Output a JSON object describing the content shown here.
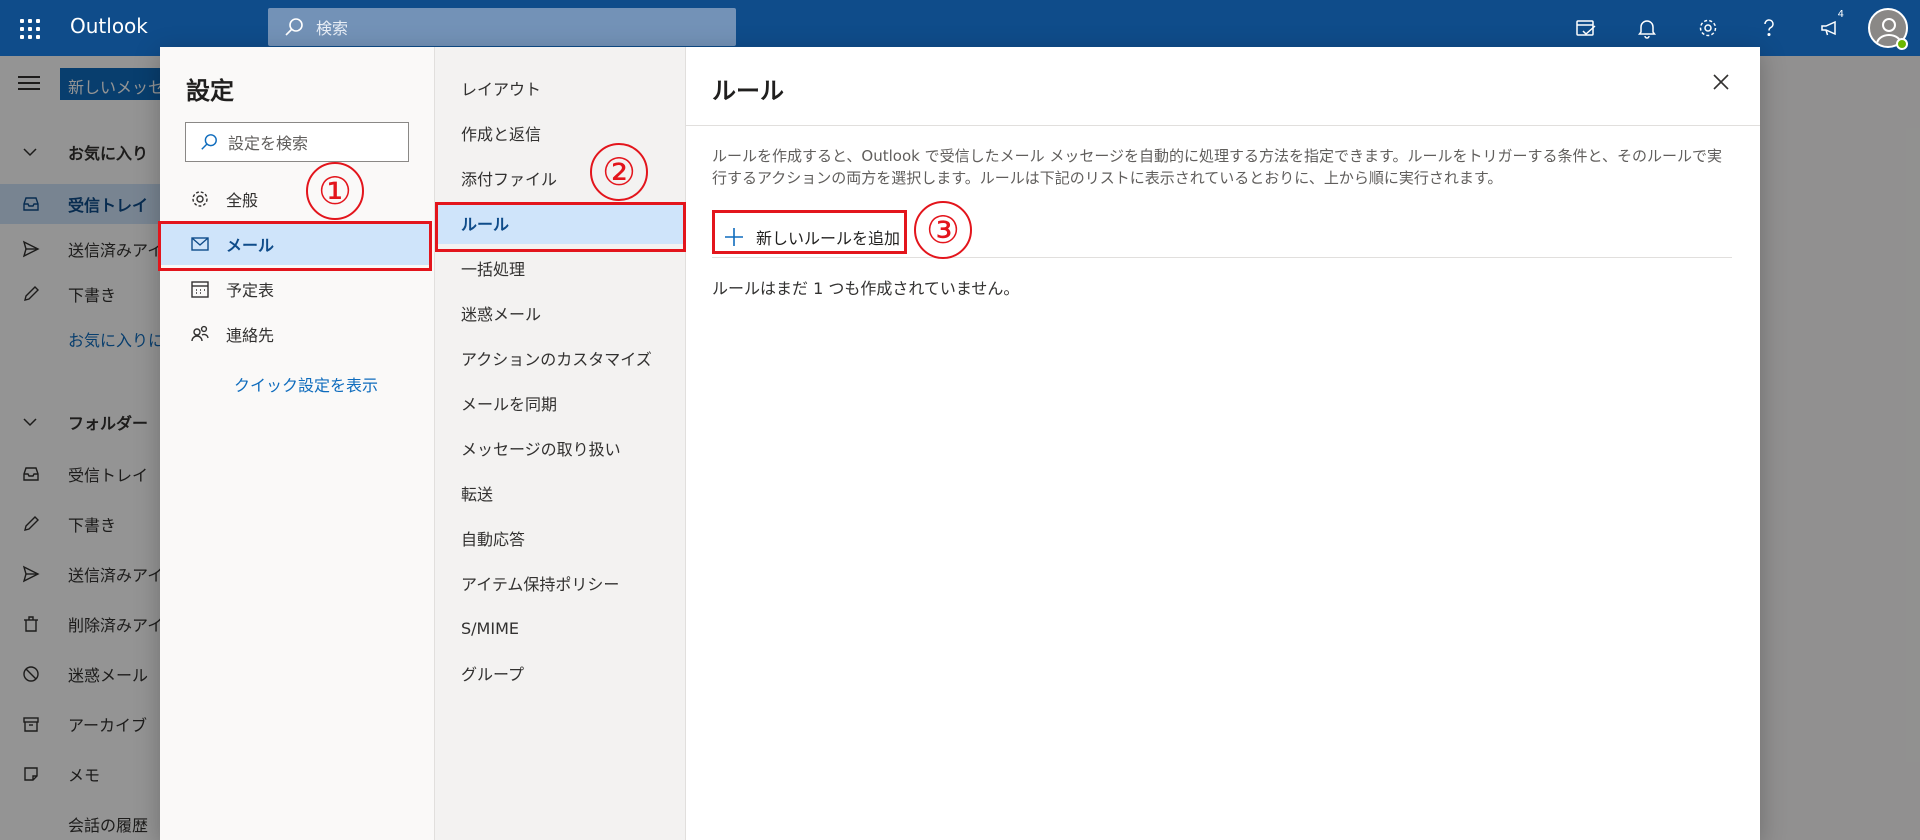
{
  "app": {
    "brand": "Outlook",
    "search_placeholder": "検索",
    "notification_count": "4"
  },
  "leftnav": {
    "new_message": "新しいメッセージ",
    "favorites_header": "お気に入り",
    "inbox": "受信トレイ",
    "sent": "送信済みアイテム",
    "drafts": "下書き",
    "add_favorite": "お気に入りに追加",
    "folders_header": "フォルダー",
    "folder_inbox": "受信トレイ",
    "folder_drafts": "下書き",
    "folder_sent": "送信済みアイテム",
    "folder_deleted": "削除済みアイテム",
    "folder_junk": "迷惑メール",
    "folder_archive": "アーカイブ",
    "folder_notes": "メモ",
    "folder_history": "会話の履歴"
  },
  "settings": {
    "title": "設定",
    "search_placeholder": "設定を検索",
    "categories": [
      {
        "label": "全般",
        "icon": "gear-icon"
      },
      {
        "label": "メール",
        "icon": "mail-icon"
      },
      {
        "label": "予定表",
        "icon": "calendar-icon"
      },
      {
        "label": "連絡先",
        "icon": "people-icon"
      }
    ],
    "quick_settings_link": "クイック設定を表示",
    "mail_sections": [
      "レイアウト",
      "作成と返信",
      "添付ファイル",
      "ルール",
      "一括処理",
      "迷惑メール",
      "アクションのカスタマイズ",
      "メールを同期",
      "メッセージの取り扱い",
      "転送",
      "自動応答",
      "アイテム保持ポリシー",
      "S/MIME",
      "グループ"
    ],
    "selected_category": "メール",
    "selected_section": "ルール"
  },
  "rules_panel": {
    "title": "ルール",
    "description": "ルールを作成すると、Outlook で受信したメール メッセージを自動的に処理する方法を指定できます。ルールをトリガーする条件と、そのルールで実行するアクションの両方を選択します。ルールは下記のリストに表示されているとおりに、上から順に実行されます。",
    "add_rule": "新しいルールを追加",
    "empty_message": "ルールはまだ 1 つも作成されていません。"
  },
  "annotations": {
    "step1": "①",
    "step2": "②",
    "step3": "③",
    "highlight_color": "#e3151c"
  },
  "colors": {
    "topbar": "#0f4c8a",
    "selected_bg": "#cfe4fa",
    "link": "#0f6cbd"
  }
}
